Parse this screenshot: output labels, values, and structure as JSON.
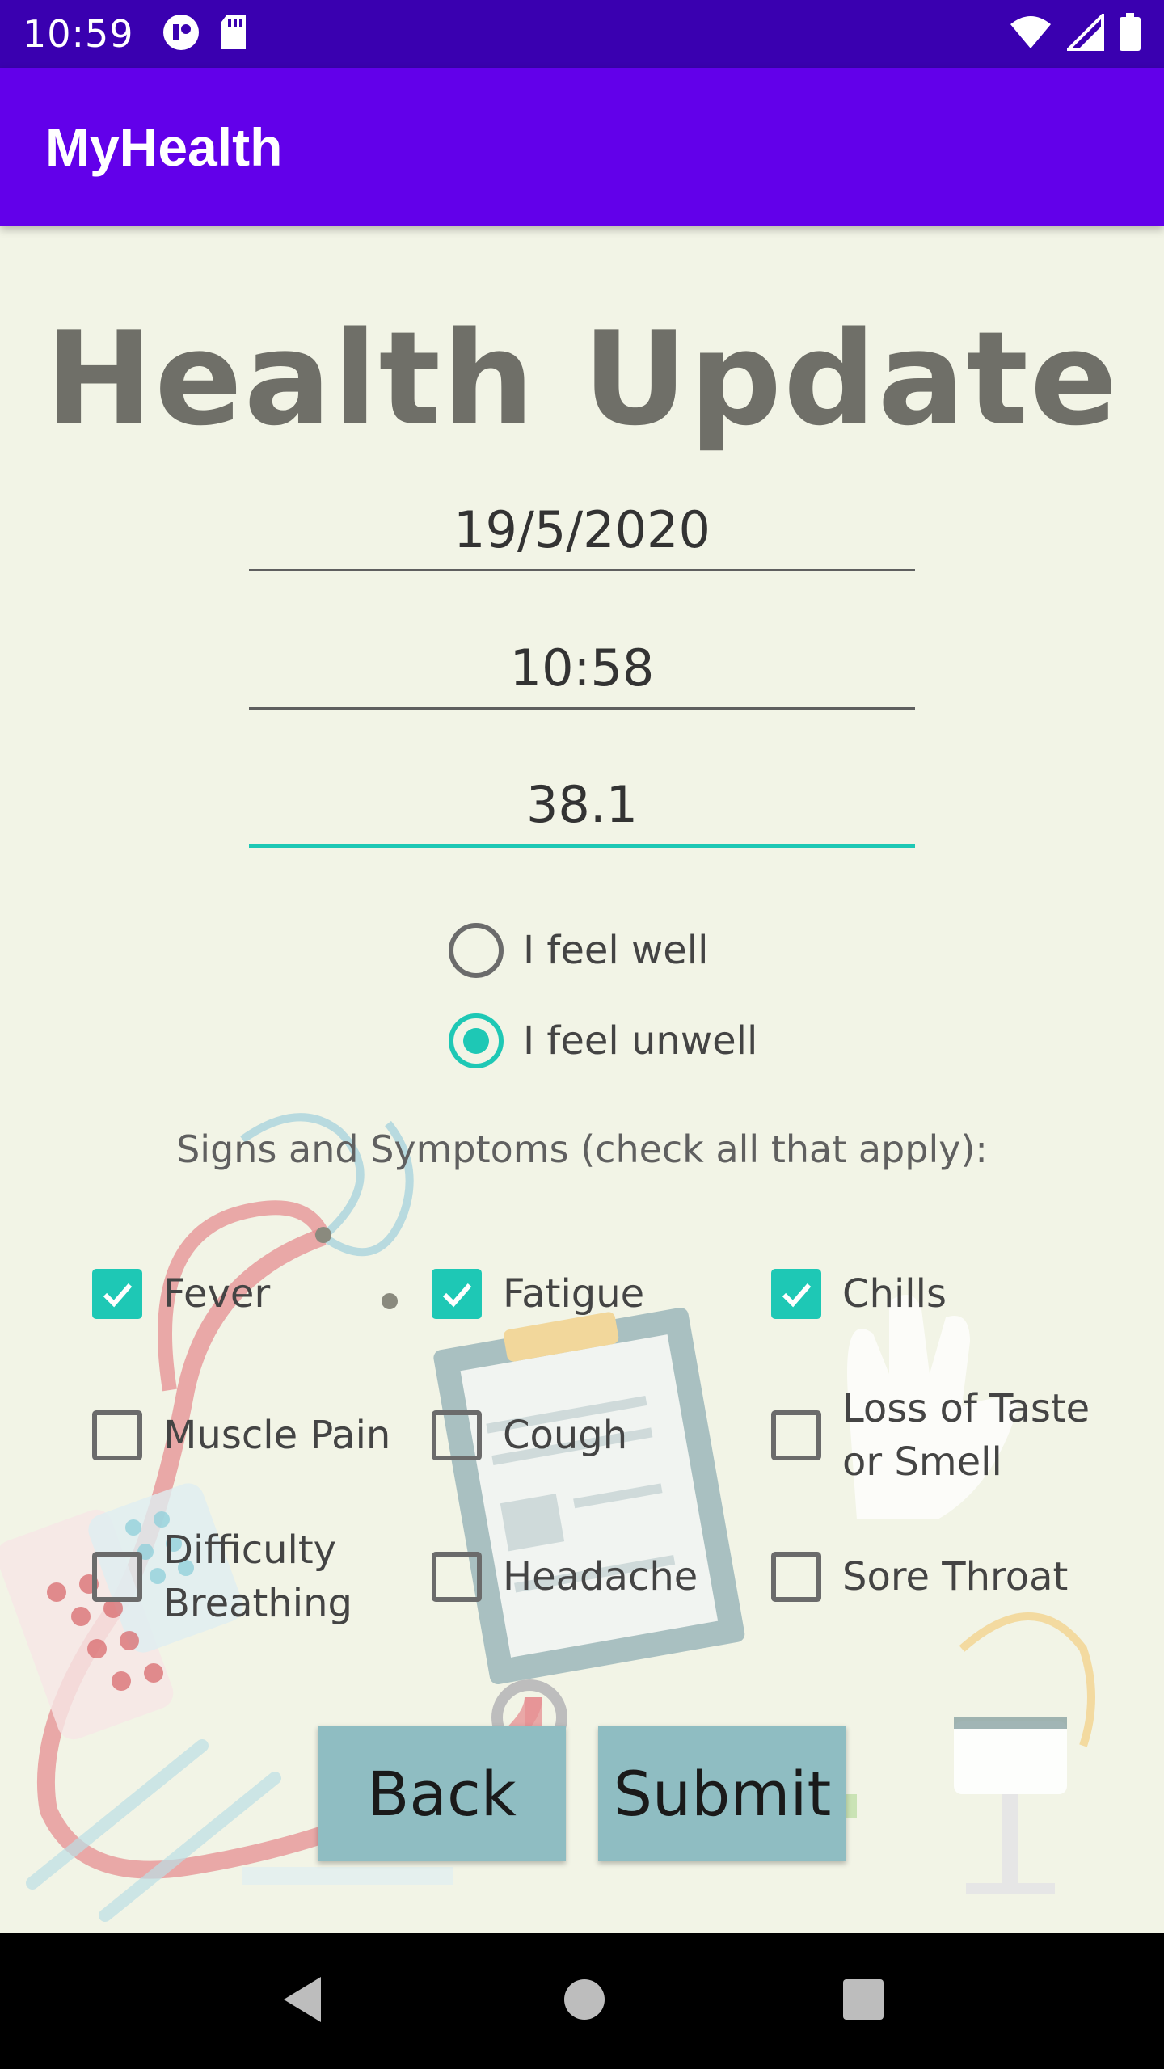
{
  "status_bar": {
    "time": "10:59",
    "icons": [
      "notification-icon",
      "sd-card-icon",
      "wifi-icon",
      "signal-icon",
      "battery-icon"
    ]
  },
  "app_bar": {
    "title": "MyHealth"
  },
  "form": {
    "title": "Health Update",
    "date_value": "19/5/2020",
    "time_value": "10:58",
    "temperature_value": "38.1",
    "radios": [
      {
        "label": "I feel well",
        "checked": false
      },
      {
        "label": "I feel unwell",
        "checked": true
      }
    ],
    "symptoms_heading": "Signs and Symptoms (check all that apply):",
    "symptoms": [
      {
        "label": "Fever",
        "checked": true
      },
      {
        "label": "Fatigue",
        "checked": true
      },
      {
        "label": "Chills",
        "checked": true
      },
      {
        "label": "Muscle Pain",
        "checked": false
      },
      {
        "label": "Cough",
        "checked": false
      },
      {
        "label": "Loss of Taste or Smell",
        "checked": false
      },
      {
        "label": "Difficulty Breathing",
        "checked": false
      },
      {
        "label": "Headache",
        "checked": false
      },
      {
        "label": "Sore Throat",
        "checked": false
      }
    ],
    "back_label": "Back",
    "submit_label": "Submit"
  },
  "colors": {
    "status_bar": "#3a00b0",
    "app_bar": "#6200ea",
    "accent": "#1ec8b5",
    "button": "#8fbdc2",
    "background": "#f2f4e6"
  }
}
